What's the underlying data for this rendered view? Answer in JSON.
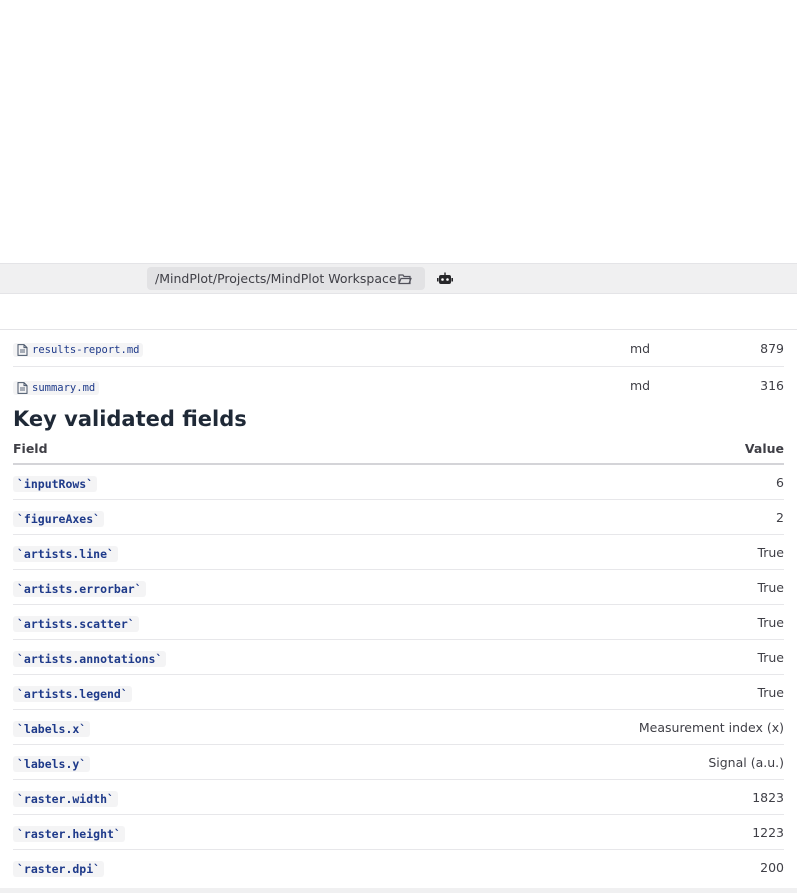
{
  "toolbar": {
    "path": "/MindPlot/Projects/MindPlot Workspace",
    "folder_icon": "folder-open-icon",
    "assistant_icon": "robot-icon"
  },
  "files": [
    {
      "name": "results-report.md",
      "type": "md",
      "size": "879"
    },
    {
      "name": "summary.md",
      "type": "md",
      "size": "316"
    }
  ],
  "section": {
    "title": "Key validated fields"
  },
  "table": {
    "headers": {
      "field": "Field",
      "value": "Value"
    },
    "rows": [
      {
        "field": "`inputRows`",
        "value": "6"
      },
      {
        "field": "`figureAxes`",
        "value": "2"
      },
      {
        "field": "`artists.line`",
        "value": "True"
      },
      {
        "field": "`artists.errorbar`",
        "value": "True"
      },
      {
        "field": "`artists.scatter`",
        "value": "True"
      },
      {
        "field": "`artists.annotations`",
        "value": "True"
      },
      {
        "field": "`artists.legend`",
        "value": "True"
      },
      {
        "field": "`labels.x`",
        "value": "Measurement index (x)"
      },
      {
        "field": "`labels.y`",
        "value": "Signal (a.u.)"
      },
      {
        "field": "`raster.width`",
        "value": "1823"
      },
      {
        "field": "`raster.height`",
        "value": "1223"
      },
      {
        "field": "`raster.dpi`",
        "value": "200"
      }
    ]
  },
  "colors": {
    "link": "#1e3a8a",
    "toolbar_bg": "#f0f0f1",
    "text": "#3f3f46"
  }
}
